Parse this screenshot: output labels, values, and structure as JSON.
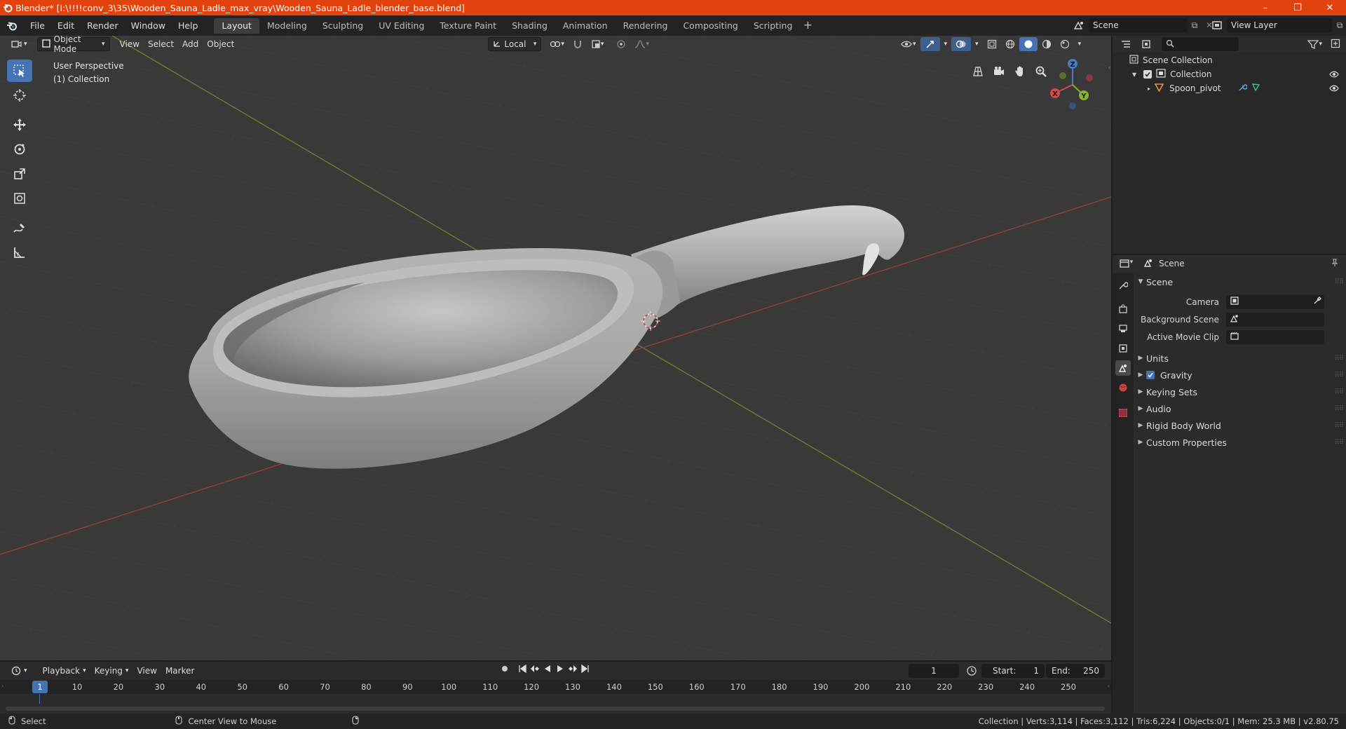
{
  "window": {
    "title": "Blender* [I:\\!!!!conv_3\\35\\Wooden_Sauna_Ladle_max_vray\\Wooden_Sauna_Ladle_blender_base.blend]",
    "minimize": "–",
    "maximize": "❐",
    "close": "✕"
  },
  "menu": {
    "file": "File",
    "edit": "Edit",
    "render": "Render",
    "window": "Window",
    "help": "Help"
  },
  "workspaces": [
    "Layout",
    "Modeling",
    "Sculpting",
    "UV Editing",
    "Texture Paint",
    "Shading",
    "Animation",
    "Rendering",
    "Compositing",
    "Scripting"
  ],
  "active_workspace": "Layout",
  "scene_selector": "Scene",
  "view_layer": "View Layer",
  "viewport": {
    "mode": "Object Mode",
    "menus": [
      "View",
      "Select",
      "Add",
      "Object"
    ],
    "transform_orientation": "Local",
    "perspective_label": "User Perspective",
    "collection_label": "(1) Collection",
    "accent_color": "#4772b3",
    "gizmo": {
      "x": "X",
      "y": "Y",
      "z": "Z"
    }
  },
  "outliner": {
    "search_placeholder": "",
    "scene_collection": "Scene Collection",
    "collection": "Collection",
    "object": "Spoon_pivot"
  },
  "properties": {
    "context": "Scene",
    "panel_title": "Scene",
    "fields": {
      "camera_label": "Camera",
      "background_scene_label": "Background Scene",
      "active_movie_clip_label": "Active Movie Clip"
    },
    "subpanels": [
      "Units",
      "Gravity",
      "Keying Sets",
      "Audio",
      "Rigid Body World",
      "Custom Properties"
    ],
    "gravity_enabled": true
  },
  "timeline": {
    "menus": [
      "Playback",
      "Keying",
      "View",
      "Marker"
    ],
    "current_frame": "1",
    "start_label": "Start:",
    "start": "1",
    "end_label": "End:",
    "end": "250",
    "ruler": [
      1,
      10,
      20,
      30,
      40,
      50,
      60,
      70,
      80,
      90,
      100,
      110,
      120,
      130,
      140,
      150,
      160,
      170,
      180,
      190,
      200,
      210,
      220,
      230,
      240,
      250
    ]
  },
  "statusbar": {
    "select": "Select",
    "center_view": "Center View to Mouse",
    "stats": "Collection | Verts:3,114 | Faces:3,112 | Tris:6,224 | Objects:0/1 | Mem: 25.3 MB | v2.80.75"
  }
}
